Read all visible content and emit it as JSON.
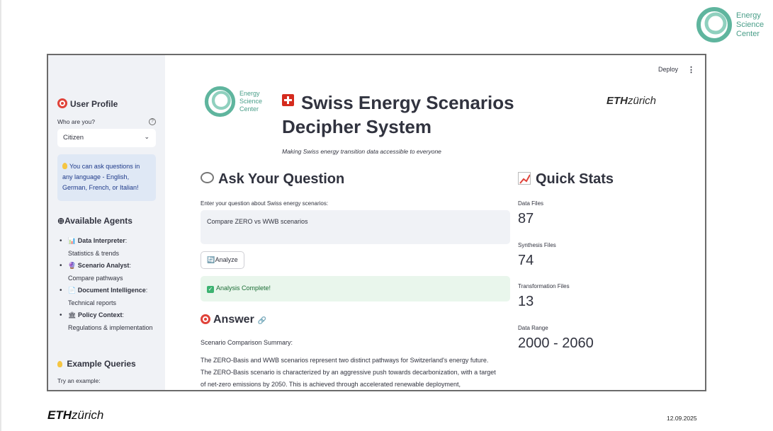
{
  "slide": {
    "logo": {
      "lines": [
        "Energy",
        "Science",
        "Center"
      ]
    },
    "footer_logo": {
      "bold": "ETH",
      "rest": "zürich"
    },
    "date": "12.09.2025"
  },
  "app": {
    "toolbar": {
      "deploy_label": "Deploy",
      "menu_icon": "kebab-menu-icon"
    },
    "sidebar": {
      "user_profile_heading": "User Profile",
      "who_label": "Who are you?",
      "role_select_value": "Citizen",
      "info_text": "You can ask questions in any language - English, German, French, or Italian!",
      "agents_heading": "Available Agents",
      "agents": [
        {
          "icon": "📊",
          "name": "Data Interpreter",
          "desc": "Statistics & trends"
        },
        {
          "icon": "🔮",
          "name": "Scenario Analyst",
          "desc": "Compare pathways"
        },
        {
          "icon": "📄",
          "name": "Document Intelligence",
          "desc": "Technical reports"
        },
        {
          "icon": "🏛",
          "name": "Policy Context",
          "desc": "Regulations & implementation"
        }
      ],
      "examples_heading": "Example Queries",
      "examples_label": "Try an example:"
    },
    "main": {
      "logo_lines": [
        "Energy",
        "Science",
        "Center"
      ],
      "title": "Swiss Energy Scenarios Decipher System",
      "eth_logo": {
        "bold": "ETH",
        "rest": "zürich"
      },
      "subtitle": "Making Swiss energy transition data accessible to everyone",
      "ask_heading": "Ask Your Question",
      "question_label": "Enter your question about Swiss energy scenarios:",
      "question_value": "Compare ZERO vs WWB scenarios",
      "analyze_button": "Analyze",
      "success_message": "Analysis Complete!",
      "answer_heading": "Answer",
      "answer_intro": "Scenario Comparison Summary:",
      "answer_lines": [
        "The ZERO-Basis and WWB scenarios represent two distinct pathways for Switzerland's energy future.",
        "The ZERO-Basis scenario is characterized by an aggressive push towards decarbonization, with a target",
        "of net-zero emissions by 2050. This is achieved through accelerated renewable deployment,"
      ],
      "stats_heading": "Quick Stats",
      "stats": [
        {
          "label": "Data Files",
          "value": "87"
        },
        {
          "label": "Synthesis Files",
          "value": "74"
        },
        {
          "label": "Transformation Files",
          "value": "13"
        },
        {
          "label": "Data Range",
          "value": "2000 - 2060"
        }
      ]
    }
  }
}
